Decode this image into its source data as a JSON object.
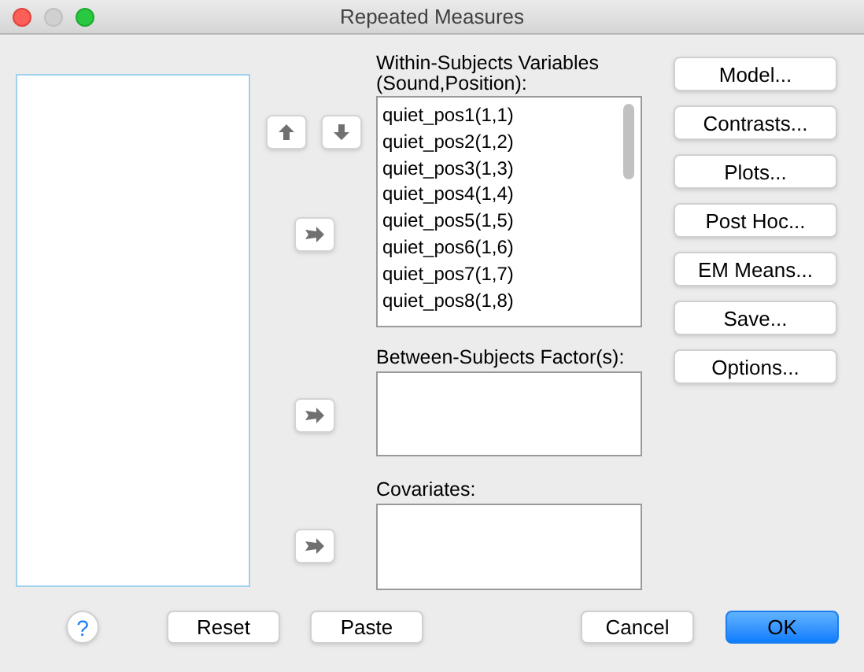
{
  "window": {
    "title": "Repeated Measures"
  },
  "within_subjects": {
    "label_lines": [
      "Within-Subjects Variables",
      "(Sound,Position):"
    ],
    "items": [
      "quiet_pos1(1,1)",
      "quiet_pos2(1,2)",
      "quiet_pos3(1,3)",
      "quiet_pos4(1,4)",
      "quiet_pos5(1,5)",
      "quiet_pos6(1,6)",
      "quiet_pos7(1,7)",
      "quiet_pos8(1,8)"
    ]
  },
  "between_subjects": {
    "label": "Between-Subjects Factor(s):"
  },
  "covariates": {
    "label": "Covariates:"
  },
  "side_buttons": [
    "Model...",
    "Contrasts...",
    "Plots...",
    "Post Hoc...",
    "EM Means...",
    "Save...",
    "Options..."
  ],
  "help": "?",
  "footer_buttons": [
    {
      "label": "Reset",
      "primary": false
    },
    {
      "label": "Paste",
      "primary": false
    },
    {
      "label": "Cancel",
      "primary": false
    },
    {
      "label": "OK",
      "primary": true
    }
  ]
}
